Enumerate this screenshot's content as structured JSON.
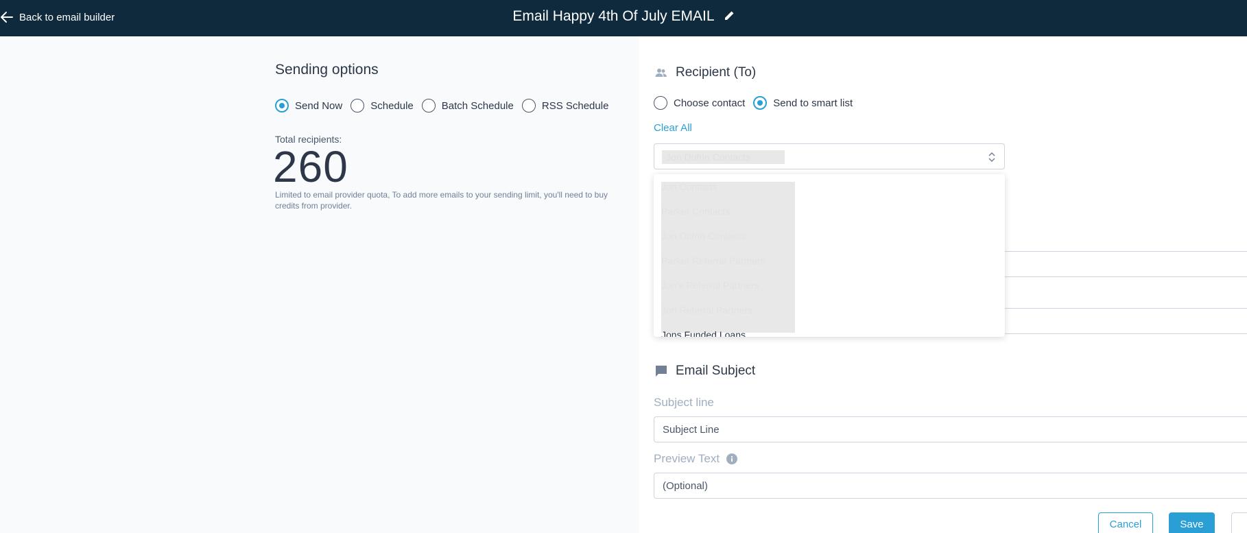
{
  "header": {
    "back_label": "Back to email builder",
    "title": "Email Happy 4th Of July EMAIL"
  },
  "sending_options": {
    "heading": "Sending options",
    "modes": [
      {
        "label": "Send Now",
        "checked": true
      },
      {
        "label": "Schedule",
        "checked": false
      },
      {
        "label": "Batch Schedule",
        "checked": false
      },
      {
        "label": "RSS Schedule",
        "checked": false
      }
    ],
    "total_label": "Total recipients:",
    "total_value": "260",
    "limit_note": "Limited to email provider quota, To add more emails to your sending limit, you'll need to buy credits from provider."
  },
  "recipient": {
    "heading": "Recipient (To)",
    "options": [
      {
        "label": "Choose contact",
        "checked": false
      },
      {
        "label": "Send to smart list",
        "checked": true
      }
    ],
    "clear_all": "Clear All",
    "selected": "Jon Dufrin Contacts",
    "dropdown_options": [
      "Jon Contacts",
      "Parker Contacts",
      "Jon Dufrin Contacts",
      "Parker Referral Partners",
      "Jon's Referral Partners",
      "Jon Referral Partners",
      "Jons Funded Loans"
    ]
  },
  "email_subject": {
    "heading": "Email Subject",
    "subject_label": "Subject line",
    "subject_value": "Subject Line",
    "preview_label": "Preview Text",
    "preview_value": "(Optional)"
  },
  "actions": {
    "cancel": "Cancel",
    "save": "Save"
  },
  "colors": {
    "header_bg": "#0f2a3d",
    "accent": "#2a9fd6"
  }
}
